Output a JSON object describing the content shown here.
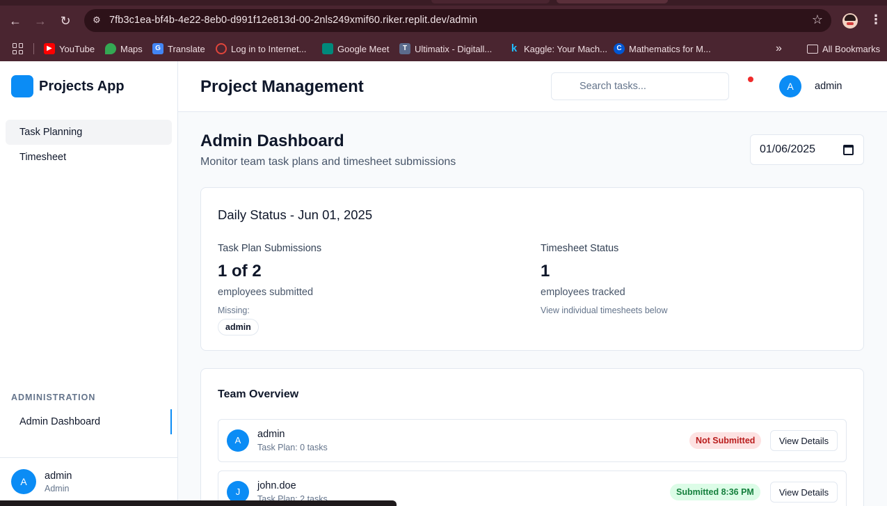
{
  "browser": {
    "url": "7fb3c1ea-bf4b-4e22-8eb0-d991f12e813d-00-2nls249xmif60.riker.replit.dev/admin",
    "bookmarks": [
      {
        "label": "YouTube",
        "color": "#ff0000"
      },
      {
        "label": "Maps",
        "color": "#34a853"
      },
      {
        "label": "Translate",
        "color": "#4285f4"
      },
      {
        "label": "Log in to Internet...",
        "color": "#e0453b"
      },
      {
        "label": "Google Meet",
        "color": "#00897b"
      },
      {
        "label": "Ultimatix - Digitall...",
        "color": "#5b6b8c"
      },
      {
        "label": "Kaggle: Your Mach...",
        "color": "#20beff"
      },
      {
        "label": "Mathematics for M...",
        "color": "#0056d2"
      }
    ],
    "overflow_label": "»",
    "all_bookmarks": "All Bookmarks"
  },
  "sidebar": {
    "app_name": "Projects App",
    "items": [
      {
        "label": "Task Planning"
      },
      {
        "label": "Timesheet"
      }
    ],
    "section_label": "ADMINISTRATION",
    "admin_item": "Admin Dashboard",
    "user": {
      "initial": "A",
      "name": "admin",
      "role": "Admin"
    }
  },
  "header": {
    "title": "Project Management",
    "search_placeholder": "Search tasks...",
    "user": {
      "initial": "A",
      "name": "admin"
    }
  },
  "main": {
    "title": "Admin Dashboard",
    "subtitle": "Monitor team task plans and timesheet submissions",
    "date_value": "01/06/2025",
    "daily_status": {
      "title": "Daily Status - Jun 01, 2025",
      "task_plan": {
        "label": "Task Plan Submissions",
        "value": "1 of 2",
        "sub": "employees submitted",
        "missing_label": "Missing:",
        "missing": [
          "admin"
        ]
      },
      "timesheet": {
        "label": "Timesheet Status",
        "value": "1",
        "sub": "employees tracked",
        "note": "View individual timesheets below"
      }
    },
    "team_overview": {
      "title": "Team Overview",
      "rows": [
        {
          "initial": "A",
          "name": "admin",
          "meta": "Task Plan: 0 tasks",
          "status": "Not Submitted",
          "action": "View Details"
        },
        {
          "initial": "J",
          "name": "john.doe",
          "meta": "Task Plan: 2 tasks",
          "status": "Submitted 8:36 PM",
          "action": "View Details"
        }
      ]
    }
  },
  "colors": {
    "accent": "#0b8cf5",
    "chrome": "#4a2530",
    "not_submitted_bg": "#fde2e2",
    "submitted_bg": "#dcfce7"
  }
}
